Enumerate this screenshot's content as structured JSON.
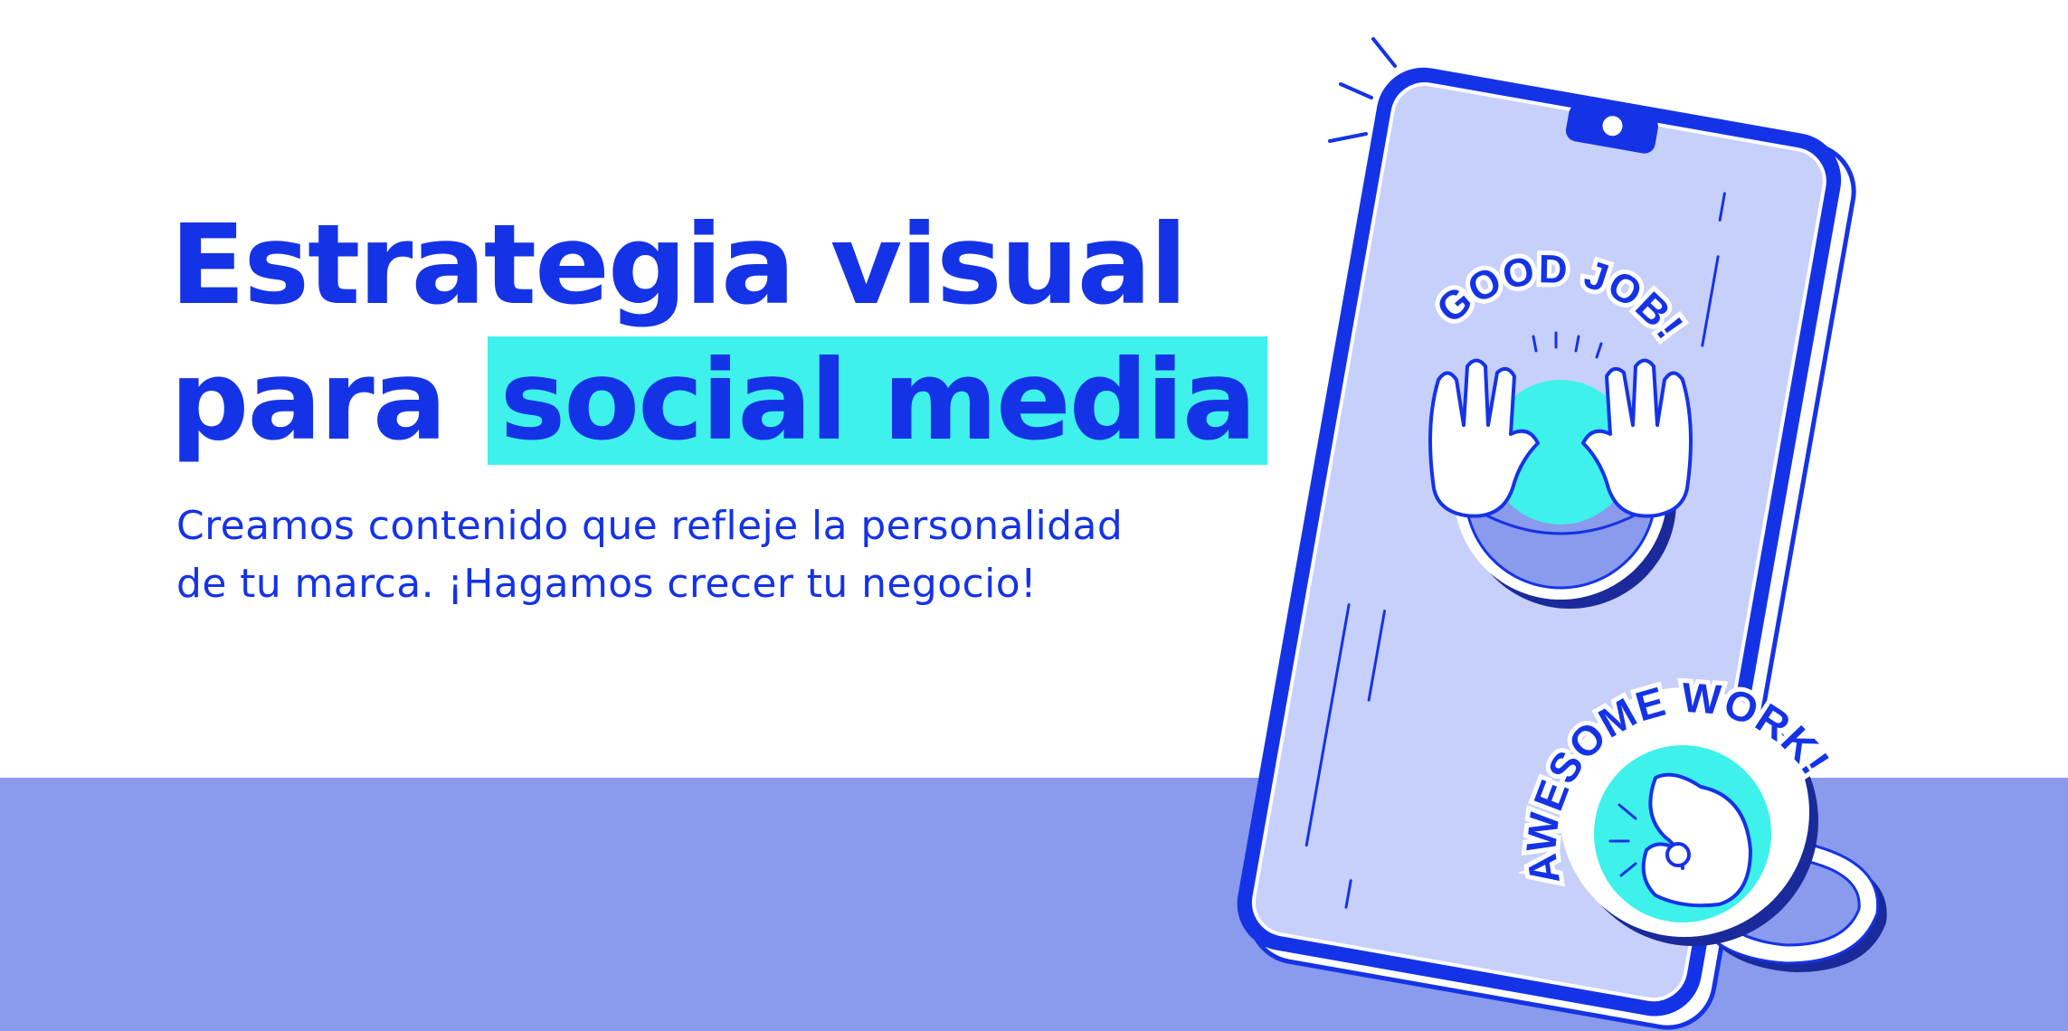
{
  "headline": {
    "line1": "Estrategia visual",
    "line2_prefix": "para",
    "line2_highlight": "social media"
  },
  "subtitle": {
    "line1": "Creamos contenido que refleje la personalidad",
    "line2": "de tu marca. ¡Hagamos crecer tu negocio!"
  },
  "stickers": {
    "good_job": "GOOD JOB!",
    "awesome_work": "AWESOME WORK!"
  },
  "colors": {
    "primary_blue": "#1533e6",
    "highlight_cyan": "#3ef1eb",
    "band_lavender": "#8a9aec",
    "screen_lavender": "#c7cffb",
    "background": "#ffffff"
  },
  "icons": [
    "phone-illustration",
    "hands-covering-face-icon",
    "hand-gesture-icon",
    "sparkle-lines-icon"
  ]
}
